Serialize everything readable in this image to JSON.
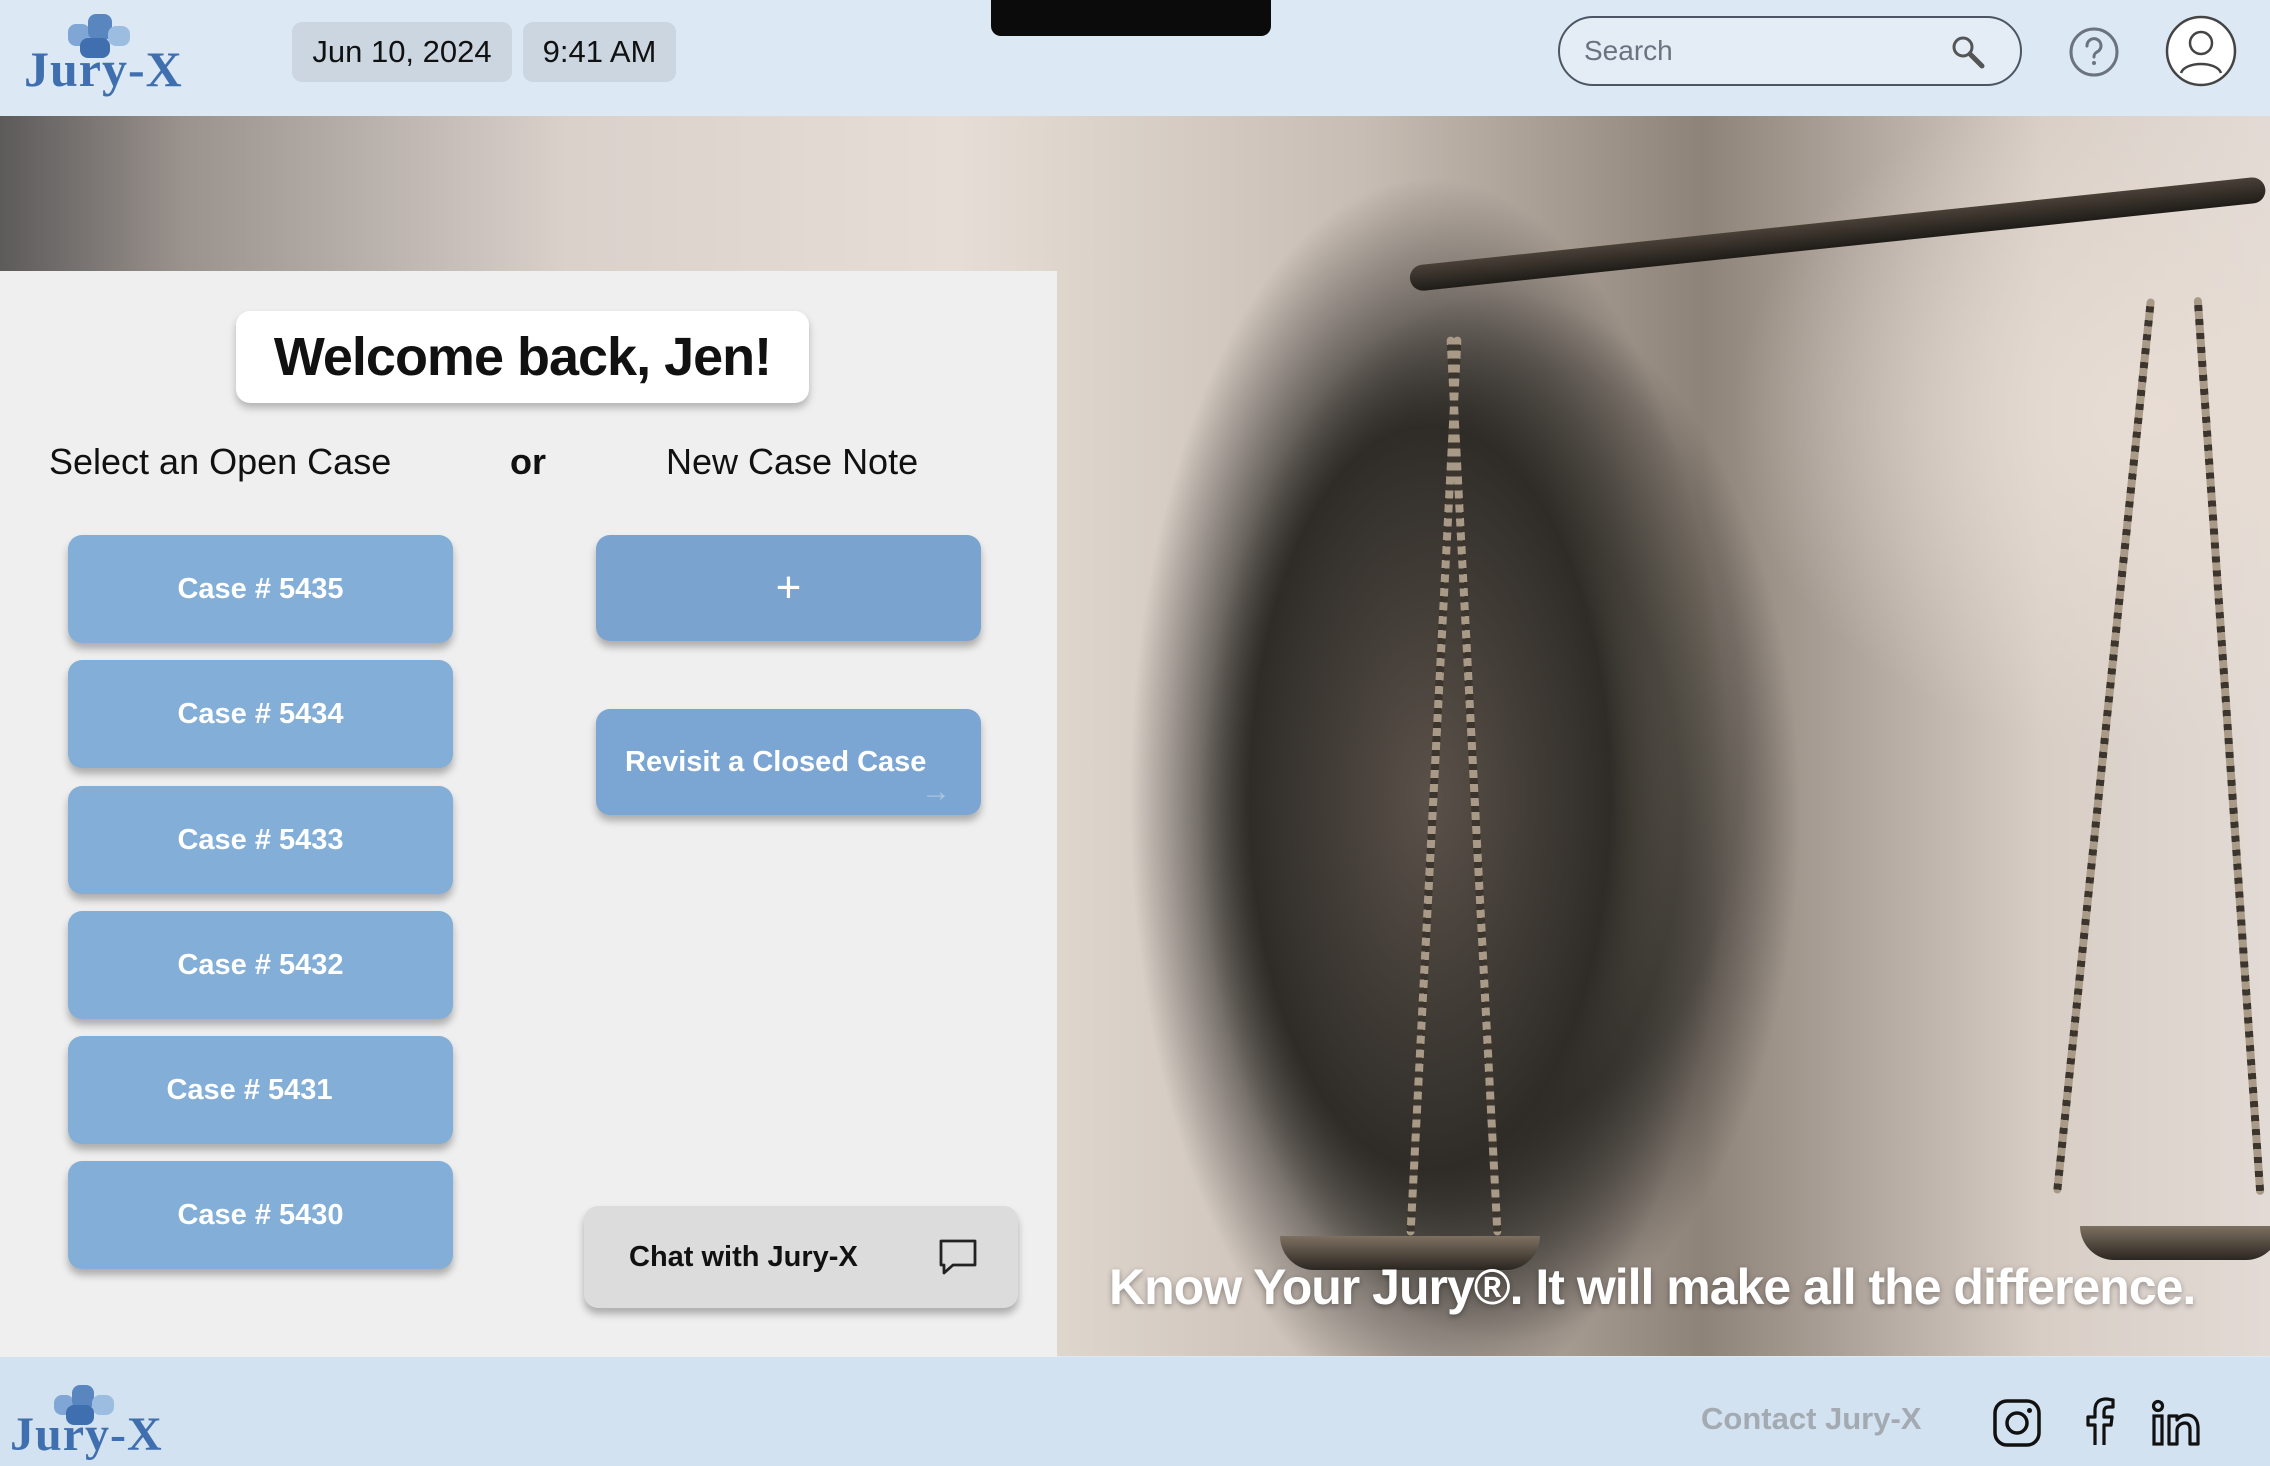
{
  "app": {
    "logo_text": "Jury-X"
  },
  "header": {
    "date": "Jun 10, 2024",
    "time": "9:41 AM",
    "search_placeholder": "Search"
  },
  "welcome": {
    "title": "Welcome back, Jen!",
    "select_label": "Select an Open Case",
    "or_label": "or",
    "new_label": "New Case Note"
  },
  "cases": [
    "Case # 5435",
    "Case # 5434",
    "Case # 5433",
    "Case # 5432",
    "Case # 5431",
    "Case # 5430"
  ],
  "actions": {
    "new_case_symbol": "+",
    "revisit_label": "Revisit a Closed Case",
    "chat_label": "Chat with Jury-X"
  },
  "hero": {
    "tagline": "Know Your Jury®.  It will make all the difference."
  },
  "footer": {
    "contact_label": "Contact Jury-X",
    "social_icons": [
      "instagram-icon",
      "facebook-icon",
      "linkedin-icon"
    ]
  },
  "colors": {
    "accent_blue": "#82aed8",
    "header_bg": "#dce9f4",
    "logo_blue": "#3f6fae"
  }
}
